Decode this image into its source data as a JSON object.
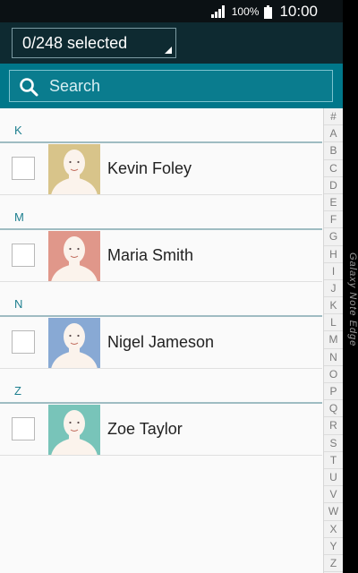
{
  "status_bar": {
    "battery_percent": "100%",
    "time": "10:00"
  },
  "header": {
    "selection_label": "0/248 selected"
  },
  "search": {
    "placeholder": "Search"
  },
  "contacts": [
    {
      "group": "K",
      "name": "Kevin Foley",
      "avatar_color": "#d8c48a",
      "checked": false
    },
    {
      "group": "M",
      "name": "Maria Smith",
      "avatar_color": "#e0978a",
      "checked": false
    },
    {
      "group": "N",
      "name": "Nigel Jameson",
      "avatar_color": "#88a9d4",
      "checked": false
    },
    {
      "group": "Z",
      "name": "Zoe Taylor",
      "avatar_color": "#78c4b9",
      "checked": false
    }
  ],
  "index_letters": [
    "#",
    "A",
    "B",
    "C",
    "D",
    "E",
    "F",
    "G",
    "H",
    "I",
    "J",
    "K",
    "L",
    "M",
    "N",
    "O",
    "P",
    "Q",
    "R",
    "S",
    "T",
    "U",
    "V",
    "W",
    "X",
    "Y",
    "Z"
  ],
  "edge_label": "Galaxy Note Edge",
  "colors": {
    "accent": "#00778a",
    "header": "#0e2a31",
    "group_letter": "#1e7f8f"
  }
}
